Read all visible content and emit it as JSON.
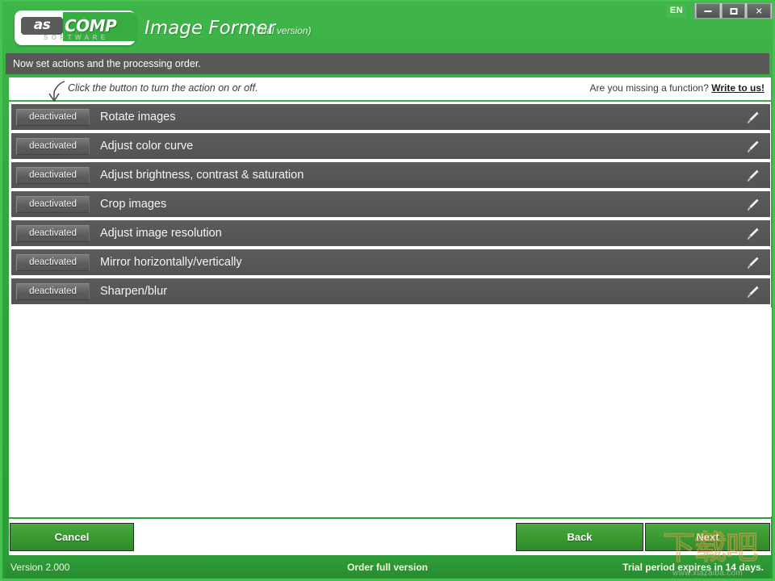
{
  "titlebar": {
    "logo_as": "as",
    "logo_comp": "COMP",
    "logo_sub": "SOFTWARE",
    "app_title": "Image Former",
    "trial_tag": "(Trial version)",
    "language": "EN",
    "minimize_label": "minimize",
    "maximize_label": "maximize",
    "close_label": "✕"
  },
  "instruction": {
    "text": "Now set actions and the processing order."
  },
  "hint": {
    "text": "Click the button to turn the action on or off.",
    "missing_prefix": "Are you missing a function?",
    "missing_link": "Write to us!"
  },
  "actions": {
    "toggle_label": "deactivated",
    "rows": [
      {
        "label": "Rotate images",
        "state": "deactivated"
      },
      {
        "label": "Adjust color curve",
        "state": "deactivated"
      },
      {
        "label": "Adjust brightness, contrast & saturation",
        "state": "deactivated"
      },
      {
        "label": "Crop images",
        "state": "deactivated"
      },
      {
        "label": "Adjust image resolution",
        "state": "deactivated"
      },
      {
        "label": "Mirror horizontally/vertically",
        "state": "deactivated"
      },
      {
        "label": "Sharpen/blur",
        "state": "deactivated"
      }
    ]
  },
  "buttons": {
    "cancel": "Cancel",
    "back": "Back",
    "next": "Next"
  },
  "statusbar": {
    "version": "Version 2.000",
    "order": "Order full version",
    "trial": "Trial period expires in 14 days."
  },
  "watermark": {
    "cjk": "下载吧",
    "url": "www.xiazaiba.com"
  },
  "colors": {
    "brand_green": "#37ad41",
    "header_gray": "#585856",
    "row_gray": "#565656",
    "status_green": "#2e9c37",
    "accent_light_green": "#46c251"
  }
}
